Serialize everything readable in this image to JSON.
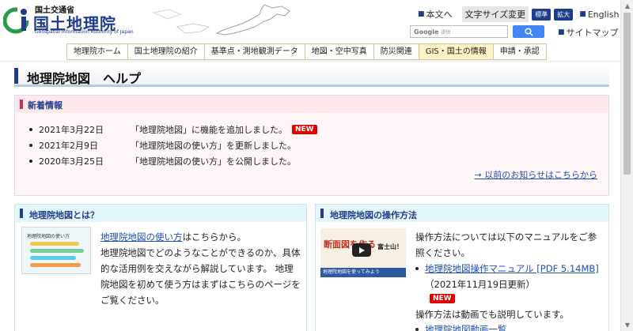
{
  "header": {
    "ministry": "国土交通省",
    "org_name": "国土地理院",
    "org_name_en": "Geospatial Information Authority of Japan",
    "top_links": {
      "japanese": "本文へ",
      "font_size_label": "文字サイズ変更",
      "font_standard": "標準",
      "font_large": "拡大",
      "english": "English"
    },
    "search": {
      "brand": "Google",
      "hint": "提供"
    },
    "sitemap": "サイトマップ"
  },
  "nav": {
    "items": [
      "地理院ホーム",
      "国土地理院の紹介",
      "基準点・測地観測データ",
      "地図・空中写真",
      "防災関連",
      "GIS・国土の情報",
      "申請・承認"
    ],
    "active": "GIS・国土の情報"
  },
  "page_title": "地理院地図　ヘルプ",
  "news": {
    "title": "新着情報",
    "items": [
      {
        "date": "2021年3月22日",
        "text": "「地理院地図」に機能を追加しました。",
        "badge": "NEW"
      },
      {
        "date": "2021年2月9日",
        "text": "「地理院地図の使い方」を更新しました。"
      },
      {
        "date": "2020年3月25日",
        "text": "「地理院地図の使い方」を公開しました。"
      }
    ],
    "prev_link": "→ 以前のお知らせはこちらから"
  },
  "about": {
    "title": "地理院地図とは？",
    "thumb_title": "地理院地図の使い方",
    "link_text": "地理院地図の使い方",
    "text_after_link": "はこちらから。",
    "body": "地理院地図でどのようなことができるのか、具体的な活用例を交えながら解説しています。 地理院地図を初めて使う方はまずはこちらのページをご覧ください。"
  },
  "operation": {
    "title": "地理院地図の操作方法",
    "thumb_big": "断面図を作る",
    "thumb_fuji": "富士山！",
    "thumb_sub": "地理院地図を使ってみよう",
    "intro": "操作方法については以下のマニュアルをご参照ください。",
    "manual_link": "地理院地図操作マニュアル [PDF 5.14MB]",
    "manual_note": "（2021年11月19日更新）",
    "manual_badge": "NEW",
    "video_text": "操作方法は動画でも説明しています。",
    "video_link": "地理院地図動画一覧"
  },
  "colors": {
    "brand_navy": "#1f3d8a",
    "link_blue": "#1f4fb4",
    "new_red": "#e00000",
    "news_bg": "#fff6f8",
    "card_head_bg": "#e3f6fb"
  }
}
